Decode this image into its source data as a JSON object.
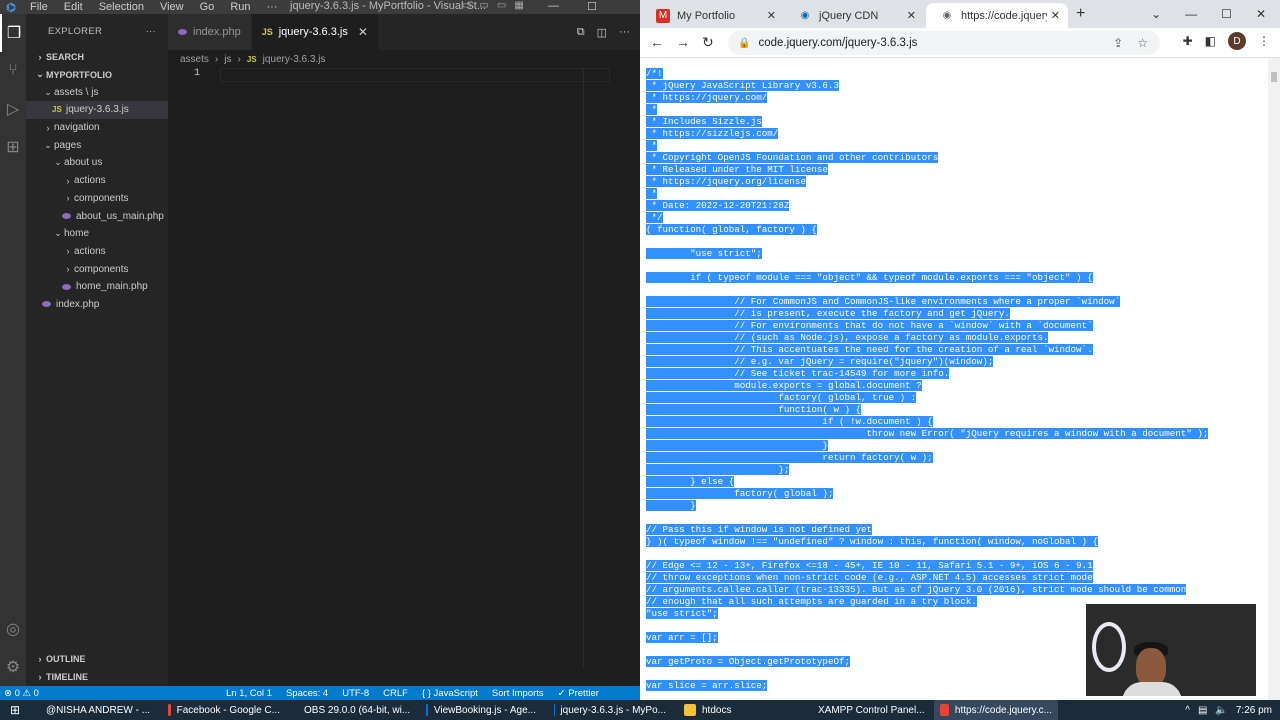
{
  "vscode": {
    "menu": [
      "File",
      "Edit",
      "Selection",
      "View",
      "Go",
      "Run",
      "···"
    ],
    "window_title": "jquery-3.6.3.js - MyPortfolio - Visual St...",
    "explorer_title": "EXPLORER",
    "explorer_more": "···",
    "sections": {
      "search": "SEARCH",
      "project": "MYPORTFOLIO",
      "outline": "OUTLINE",
      "timeline": "TIMELINE"
    },
    "tree": [
      {
        "label": "assets \\ js",
        "kind": "folder-open",
        "indent": 1
      },
      {
        "label": "jquery-3.6.3.js",
        "kind": "js",
        "indent": 2,
        "selected": true
      },
      {
        "label": "navigation",
        "kind": "folder-closed",
        "indent": 1
      },
      {
        "label": "pages",
        "kind": "folder-open",
        "indent": 1
      },
      {
        "label": "about us",
        "kind": "folder-open",
        "indent": 2
      },
      {
        "label": "actions",
        "kind": "folder-closed",
        "indent": 3
      },
      {
        "label": "components",
        "kind": "folder-closed",
        "indent": 3
      },
      {
        "label": "about_us_main.php",
        "kind": "php",
        "indent": 3
      },
      {
        "label": "home",
        "kind": "folder-open",
        "indent": 2
      },
      {
        "label": "actions",
        "kind": "folder-closed",
        "indent": 3
      },
      {
        "label": "components",
        "kind": "folder-closed",
        "indent": 3
      },
      {
        "label": "home_main.php",
        "kind": "php",
        "indent": 3
      },
      {
        "label": "index.php",
        "kind": "php",
        "indent": 1
      }
    ],
    "tabs": [
      {
        "label": "index.php",
        "kind": "php",
        "active": false
      },
      {
        "label": "jquery-3.6.3.js",
        "kind": "js",
        "active": true
      }
    ],
    "breadcrumb": [
      "assets",
      "js",
      "jquery-3.6.3.js"
    ],
    "line_number": "1",
    "status": {
      "errors": "⊗ 0 ⚠ 0",
      "position": "Ln 1, Col 1",
      "spaces": "Spaces: 4",
      "encoding": "UTF-8",
      "eol": "CRLF",
      "language": "{ } JavaScript",
      "sort": "Sort Imports",
      "prettier": "✓ Prettier"
    }
  },
  "chrome": {
    "tabs": [
      {
        "label": "My Portfolio",
        "favicon": "M",
        "favicon_color": "#d93025"
      },
      {
        "label": "jQuery CDN",
        "favicon": "◉",
        "favicon_color": "#0769ad"
      },
      {
        "label": "https://code.jquery.c",
        "favicon": "◉",
        "favicon_color": "#5f6368"
      }
    ],
    "url": "code.jquery.com/jquery-3.6.3.js",
    "avatar_letter": "D",
    "source_lines": [
      "/*!",
      " * jQuery JavaScript Library v3.6.3",
      " * https://jquery.com/",
      " *",
      " * Includes Sizzle.js",
      " * https://sizzlejs.com/",
      " *",
      " * Copyright OpenJS Foundation and other contributors",
      " * Released under the MIT license",
      " * https://jquery.org/license",
      " *",
      " * Date: 2022-12-20T21:28Z",
      " */",
      "( function( global, factory ) {",
      "",
      "        \"use strict\";",
      "",
      "        if ( typeof module === \"object\" && typeof module.exports === \"object\" ) {",
      "",
      "                // For CommonJS and CommonJS-like environments where a proper `window`",
      "                // is present, execute the factory and get jQuery.",
      "                // For environments that do not have a `window` with a `document`",
      "                // (such as Node.js), expose a factory as module.exports.",
      "                // This accentuates the need for the creation of a real `window`.",
      "                // e.g. var jQuery = require(\"jquery\")(window);",
      "                // See ticket trac-14549 for more info.",
      "                module.exports = global.document ?",
      "                        factory( global, true ) :",
      "                        function( w ) {",
      "                                if ( !w.document ) {",
      "                                        throw new Error( \"jQuery requires a window with a document\" );",
      "                                }",
      "                                return factory( w );",
      "                        };",
      "        } else {",
      "                factory( global );",
      "        }",
      "",
      "// Pass this if window is not defined yet",
      "} )( typeof window !== \"undefined\" ? window : this, function( window, noGlobal ) {",
      "",
      "// Edge <= 12 - 13+, Firefox <=18 - 45+, IE 10 - 11, Safari 5.1 - 9+, iOS 6 - 9.1",
      "// throw exceptions when non-strict code (e.g., ASP.NET 4.5) accesses strict mode",
      "// arguments.callee.caller (trac-13335). But as of jQuery 3.0 (2016), strict mode should be common",
      "// enough that all such attempts are guarded in a try block.",
      "\"use strict\";",
      "",
      "var arr = [];",
      "",
      "var getProto = Object.getPrototypeOf;",
      "",
      "var slice = arr.slice;"
    ]
  },
  "taskbar": {
    "items": [
      {
        "label": "@NISHA ANDREW - ...",
        "icon_color": "#5865f2"
      },
      {
        "label": "Facebook - Google C...",
        "icon_color": "#ea4335"
      },
      {
        "label": "OBS 29.0.0 (64-bit, wi...",
        "icon_color": "#444"
      },
      {
        "label": "ViewBooking.js - Age...",
        "icon_color": "#0078d4"
      },
      {
        "label": "jquery-3.6.3.js - MyPo...",
        "icon_color": "#0078d4"
      },
      {
        "label": "htdocs",
        "icon_color": "#f3c13a"
      },
      {
        "label": "XAMPP Control Panel...",
        "icon_color": "#fb7a24"
      },
      {
        "label": "https://code.jquery.c...",
        "icon_color": "#ea4335"
      }
    ],
    "time": "7:26 pm"
  }
}
